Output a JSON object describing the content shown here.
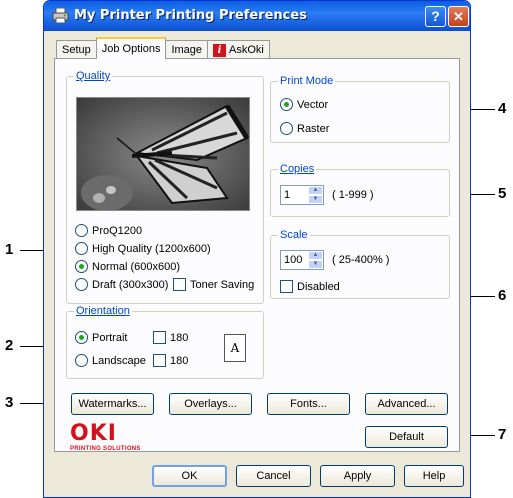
{
  "window": {
    "title": "My Printer Printing Preferences",
    "help_label": "?",
    "close_label": "✕"
  },
  "tabs": [
    "Setup",
    "Job Options",
    "Image",
    "AskOki"
  ],
  "tab_icon": "i",
  "quality": {
    "title": "Quality",
    "options": [
      "ProQ1200",
      "High Quality (1200x600)",
      "Normal (600x600)",
      "Draft (300x300)"
    ],
    "selected": "Normal (600x600)",
    "toner_saving_label": "Toner Saving"
  },
  "orientation": {
    "title": "Orientation",
    "portrait_label": "Portrait",
    "landscape_label": "Landscape",
    "rotate_label": "180",
    "selected": "Portrait",
    "page_letter": "A"
  },
  "print_mode": {
    "title": "Print Mode",
    "vector_label": "Vector",
    "raster_label": "Raster",
    "selected": "Vector"
  },
  "copies": {
    "title": "Copies",
    "value": "1",
    "range": "( 1-999 )"
  },
  "scale": {
    "title": "Scale",
    "value": "100",
    "range": "( 25-400% )",
    "disabled_label": "Disabled"
  },
  "buttons": {
    "watermarks": "Watermarks...",
    "overlays": "Overlays...",
    "fonts": "Fonts...",
    "advanced": "Advanced...",
    "default": "Default",
    "ok": "OK",
    "cancel": "Cancel",
    "apply": "Apply",
    "help": "Help"
  },
  "logo": {
    "name": "OKI",
    "tagline": "PRINTING SOLUTIONS"
  },
  "callouts": [
    "1",
    "2",
    "3",
    "4",
    "5",
    "6",
    "7"
  ],
  "colors": {
    "titlebar": "#0a5fe0",
    "group_title": "#0046d5",
    "logo": "#d7111a"
  },
  "icons": {
    "title": "printer-icon",
    "tab_askoki": "info-icon",
    "preview": "butterfly-preview-image",
    "orientation": "page-portrait-icon"
  }
}
